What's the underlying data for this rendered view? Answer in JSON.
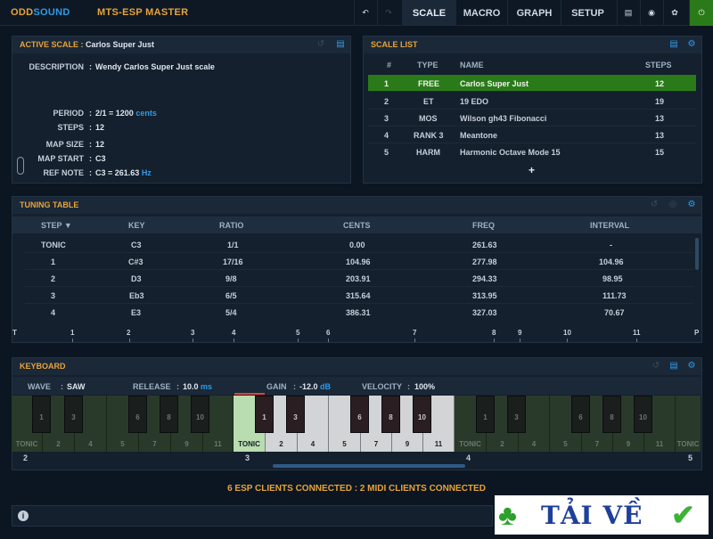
{
  "brand": {
    "odd": "ODD",
    "sound": "SOUND",
    "product": "MTS-ESP MASTER"
  },
  "tabs": [
    "SCALE",
    "MACRO",
    "GRAPH",
    "SETUP"
  ],
  "active_scale": {
    "title_prefix": "ACTIVE SCALE :",
    "name": "Carlos Super Just",
    "description_label": "DESCRIPTION",
    "description": "Wendy Carlos Super Just scale",
    "period_label": "PERIOD",
    "period": "2/1",
    "period_cents": "= 1200",
    "cents_unit": "cents",
    "steps_label": "STEPS",
    "steps": "12",
    "map_size_label": "MAP SIZE",
    "map_size": "12",
    "map_start_label": "MAP START",
    "map_start": "C3",
    "ref_note_label": "REF NOTE",
    "ref_note": "C3 = 261.63",
    "hz_unit": "Hz"
  },
  "scale_list": {
    "title": "SCALE LIST",
    "columns": [
      "#",
      "TYPE",
      "NAME",
      "STEPS"
    ],
    "rows": [
      {
        "num": "1",
        "type": "FREE",
        "name": "Carlos Super Just",
        "steps": "12"
      },
      {
        "num": "2",
        "type": "ET",
        "name": "19 EDO",
        "steps": "19"
      },
      {
        "num": "3",
        "type": "MOS",
        "name": "Wilson gh43 Fibonacci",
        "steps": "13"
      },
      {
        "num": "4",
        "type": "RANK 3",
        "name": "Meantone",
        "steps": "13"
      },
      {
        "num": "5",
        "type": "HARM",
        "name": "Harmonic Octave Mode 15",
        "steps": "15"
      }
    ],
    "add_label": "+"
  },
  "tuning": {
    "title": "TUNING TABLE",
    "columns": [
      "STEP ▼",
      "KEY",
      "RATIO",
      "CENTS",
      "FREQ",
      "INTERVAL"
    ],
    "rows": [
      {
        "step": "TONIC",
        "key": "C3",
        "ratio": "1/1",
        "cents": "0.00",
        "freq": "261.63",
        "interval": "-"
      },
      {
        "step": "1",
        "key": "C#3",
        "ratio": "17/16",
        "cents": "104.96",
        "freq": "277.98",
        "interval": "104.96"
      },
      {
        "step": "2",
        "key": "D3",
        "ratio": "9/8",
        "cents": "203.91",
        "freq": "294.33",
        "interval": "98.95"
      },
      {
        "step": "3",
        "key": "Eb3",
        "ratio": "6/5",
        "cents": "315.64",
        "freq": "313.95",
        "interval": "111.73"
      },
      {
        "step": "4",
        "key": "E3",
        "ratio": "5/4",
        "cents": "386.31",
        "freq": "327.03",
        "interval": "70.67"
      }
    ],
    "ruler": [
      "T",
      "1",
      "2",
      "3",
      "4",
      "5",
      "6",
      "7",
      "8",
      "9",
      "10",
      "11",
      "P"
    ]
  },
  "keyboard": {
    "title": "KEYBOARD",
    "wave_label": "WAVE",
    "wave": "SAW",
    "release_label": "RELEASE",
    "release": "10.0",
    "ms_unit": "ms",
    "gain_label": "GAIN",
    "gain": "-12.0",
    "db_unit": "dB",
    "velocity_label": "VELOCITY",
    "velocity": "100%",
    "octaves": [
      "2",
      "3",
      "4",
      "5"
    ]
  },
  "status": "6 ESP CLIENTS CONNECTED : 2 MIDI CLIENTS CONNECTED",
  "watermark": "TẢI VỀ",
  "colors": {
    "accent": "#e8a33a",
    "brand_blue": "#2f9be8",
    "selected": "#2b7a1a"
  }
}
